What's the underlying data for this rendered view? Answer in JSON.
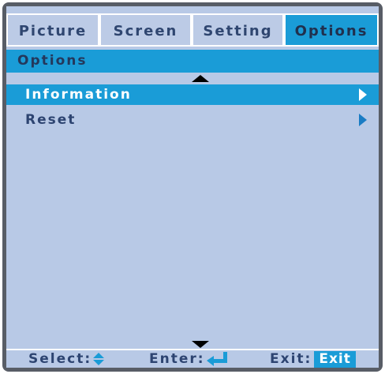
{
  "tabs": [
    {
      "label": "Picture",
      "active": false
    },
    {
      "label": "Screen",
      "active": false
    },
    {
      "label": "Setting",
      "active": false
    },
    {
      "label": "Options",
      "active": true
    }
  ],
  "section": {
    "title": "Options"
  },
  "menu": {
    "items": [
      {
        "label": "Information",
        "selected": true
      },
      {
        "label": "Reset",
        "selected": false
      }
    ]
  },
  "footer": {
    "select_label": "Select:",
    "enter_label": "Enter:",
    "exit_label": "Exit:",
    "exit_badge": "Exit"
  },
  "icons": {
    "scroll_up": "triangle-up-icon",
    "scroll_down": "triangle-down-icon",
    "submenu": "chevron-right-icon",
    "select": "up-down-arrows-icon",
    "enter": "enter-return-icon"
  },
  "colors": {
    "accent": "#1a9cd7",
    "panel": "#b8c9e6",
    "text": "#2d4471",
    "frame": "#585d66"
  }
}
